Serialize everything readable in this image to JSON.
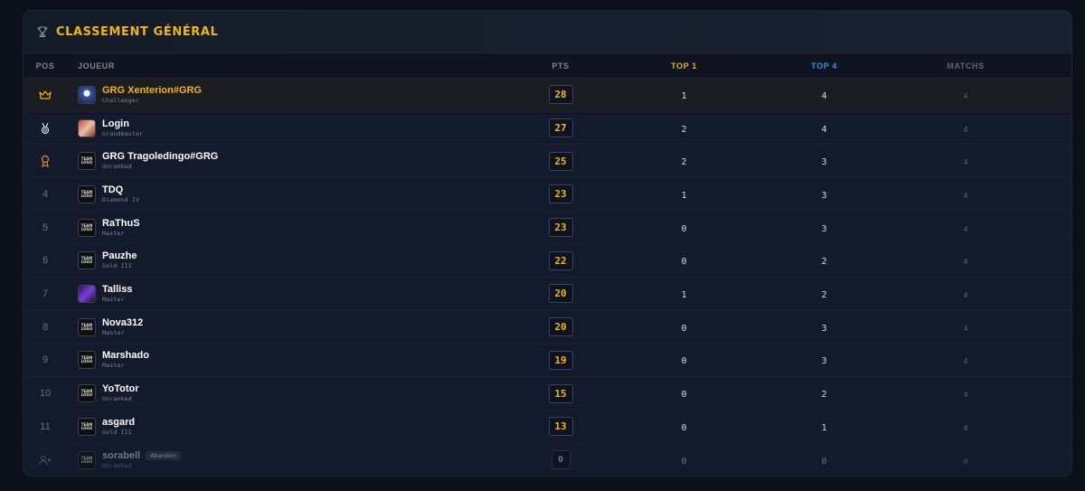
{
  "header": {
    "title": "CLASSEMENT GÉNÉRAL",
    "icon": "trophy-icon"
  },
  "columns": {
    "pos": "POS",
    "player": "JOUEUR",
    "pts": "PTS",
    "top1": "TOP 1",
    "top4": "TOP 4",
    "matches": "MATCHS"
  },
  "colors": {
    "accent": "#f2b705",
    "top4": "#3a8ee0"
  },
  "rows": [
    {
      "pos": "",
      "pos_icon": "crown-icon",
      "name": "GRG Xenterion#GRG",
      "rank": "Challenger",
      "pts": "28",
      "top1": "1",
      "top4": "4",
      "matches": "4"
    },
    {
      "pos": "",
      "pos_icon": "silver-medal-icon",
      "name": "Login",
      "rank": "Grandmaster",
      "pts": "27",
      "top1": "2",
      "top4": "4",
      "matches": "4"
    },
    {
      "pos": "",
      "pos_icon": "bronze-medal-icon",
      "name": "GRG Tragoledingo#GRG",
      "rank": "Unranked",
      "pts": "25",
      "top1": "2",
      "top4": "3",
      "matches": "4"
    },
    {
      "pos": "4",
      "name": "TDQ",
      "rank": "Diamond IV",
      "pts": "23",
      "top1": "1",
      "top4": "3",
      "matches": "4"
    },
    {
      "pos": "5",
      "name": "RaThuS",
      "rank": "Master",
      "pts": "23",
      "top1": "0",
      "top4": "3",
      "matches": "4"
    },
    {
      "pos": "6",
      "name": "Pauzhe",
      "rank": "Gold III",
      "pts": "22",
      "top1": "0",
      "top4": "2",
      "matches": "4"
    },
    {
      "pos": "7",
      "name": "Talliss",
      "rank": "Master",
      "pts": "20",
      "top1": "1",
      "top4": "2",
      "matches": "4"
    },
    {
      "pos": "8",
      "name": "Nova312",
      "rank": "Master",
      "pts": "20",
      "top1": "0",
      "top4": "3",
      "matches": "4"
    },
    {
      "pos": "9",
      "name": "Marshado",
      "rank": "Master",
      "pts": "19",
      "top1": "0",
      "top4": "3",
      "matches": "4"
    },
    {
      "pos": "10",
      "name": "YoTotor",
      "rank": "Unranked",
      "pts": "15",
      "top1": "0",
      "top4": "2",
      "matches": "4"
    },
    {
      "pos": "11",
      "name": "asgard",
      "rank": "Gold III",
      "pts": "13",
      "top1": "0",
      "top4": "1",
      "matches": "4"
    },
    {
      "pos": "",
      "pos_icon": "user-x-icon",
      "name": "sorabell",
      "rank": "Unranked",
      "badge": "Abandon",
      "pts": "0",
      "top1": "0",
      "top4": "0",
      "matches": "0"
    }
  ],
  "team_logo_text": "TEAM LOGO"
}
